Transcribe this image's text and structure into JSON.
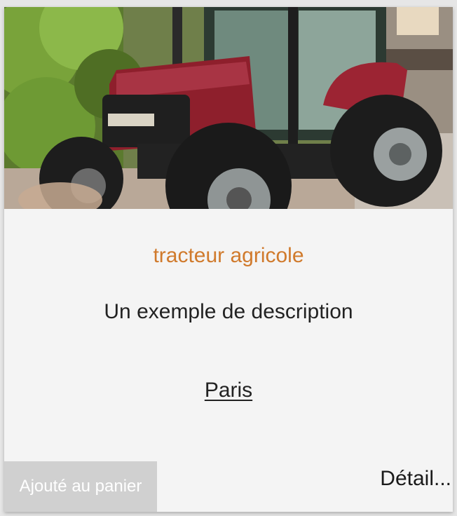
{
  "product": {
    "title": "tracteur agricole",
    "description": "Un exemple de description",
    "location": "Paris",
    "cart_button_label": "Ajouté au panier",
    "detail_link_label": "Détail..."
  },
  "colors": {
    "title": "#d07a2c",
    "card_background": "#f4f4f4",
    "cart_button_background": "#d0d0d0"
  }
}
